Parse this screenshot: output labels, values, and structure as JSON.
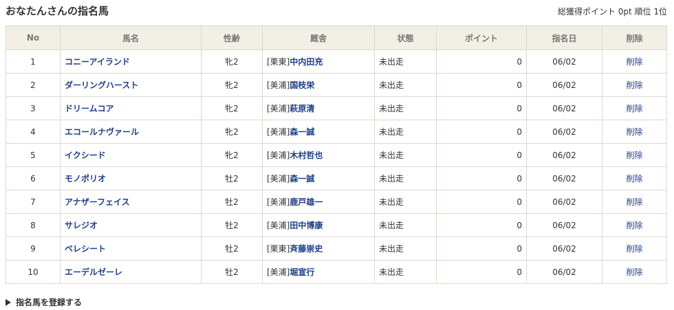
{
  "header": {
    "title": "おなたんさんの指名馬",
    "summary": "総獲得ポイント 0pt 順位 1位"
  },
  "table": {
    "columns": [
      "No",
      "馬名",
      "性齢",
      "厩舎",
      "状態",
      "ポイント",
      "指名日",
      "削除"
    ],
    "rows": [
      {
        "no": "1",
        "name": "コニーアイランド",
        "sexage": "牝2",
        "area": "[栗東]",
        "trainer": "中内田充",
        "status": "未出走",
        "points": "0",
        "date": "06/02",
        "del": "削除"
      },
      {
        "no": "2",
        "name": "ダーリングハースト",
        "sexage": "牝2",
        "area": "[美浦]",
        "trainer": "国枝栄",
        "status": "未出走",
        "points": "0",
        "date": "06/02",
        "del": "削除"
      },
      {
        "no": "3",
        "name": "ドリームコア",
        "sexage": "牝2",
        "area": "[美浦]",
        "trainer": "萩原清",
        "status": "未出走",
        "points": "0",
        "date": "06/02",
        "del": "削除"
      },
      {
        "no": "4",
        "name": "エコールナヴァール",
        "sexage": "牝2",
        "area": "[美浦]",
        "trainer": "森一誠",
        "status": "未出走",
        "points": "0",
        "date": "06/02",
        "del": "削除"
      },
      {
        "no": "5",
        "name": "イクシード",
        "sexage": "牝2",
        "area": "[美浦]",
        "trainer": "木村哲也",
        "status": "未出走",
        "points": "0",
        "date": "06/02",
        "del": "削除"
      },
      {
        "no": "6",
        "name": "モノポリオ",
        "sexage": "牡2",
        "area": "[美浦]",
        "trainer": "森一誠",
        "status": "未出走",
        "points": "0",
        "date": "06/02",
        "del": "削除"
      },
      {
        "no": "7",
        "name": "アナザーフェイス",
        "sexage": "牡2",
        "area": "[美浦]",
        "trainer": "鹿戸雄一",
        "status": "未出走",
        "points": "0",
        "date": "06/02",
        "del": "削除"
      },
      {
        "no": "8",
        "name": "サレジオ",
        "sexage": "牡2",
        "area": "[美浦]",
        "trainer": "田中博康",
        "status": "未出走",
        "points": "0",
        "date": "06/02",
        "del": "削除"
      },
      {
        "no": "9",
        "name": "ベレシート",
        "sexage": "牡2",
        "area": "[栗東]",
        "trainer": "斉藤崇史",
        "status": "未出走",
        "points": "0",
        "date": "06/02",
        "del": "削除"
      },
      {
        "no": "10",
        "name": "エーデルゼーレ",
        "sexage": "牡2",
        "area": "[美浦]",
        "trainer": "堀宣行",
        "status": "未出走",
        "points": "0",
        "date": "06/02",
        "del": "削除"
      }
    ]
  },
  "footer": {
    "register_label": "指名馬を登録する",
    "register_icon": "triangle-right-icon"
  },
  "colors": {
    "header_bg": "#f2efe4",
    "border": "#dcd8cc",
    "link": "#1d3f8a"
  }
}
